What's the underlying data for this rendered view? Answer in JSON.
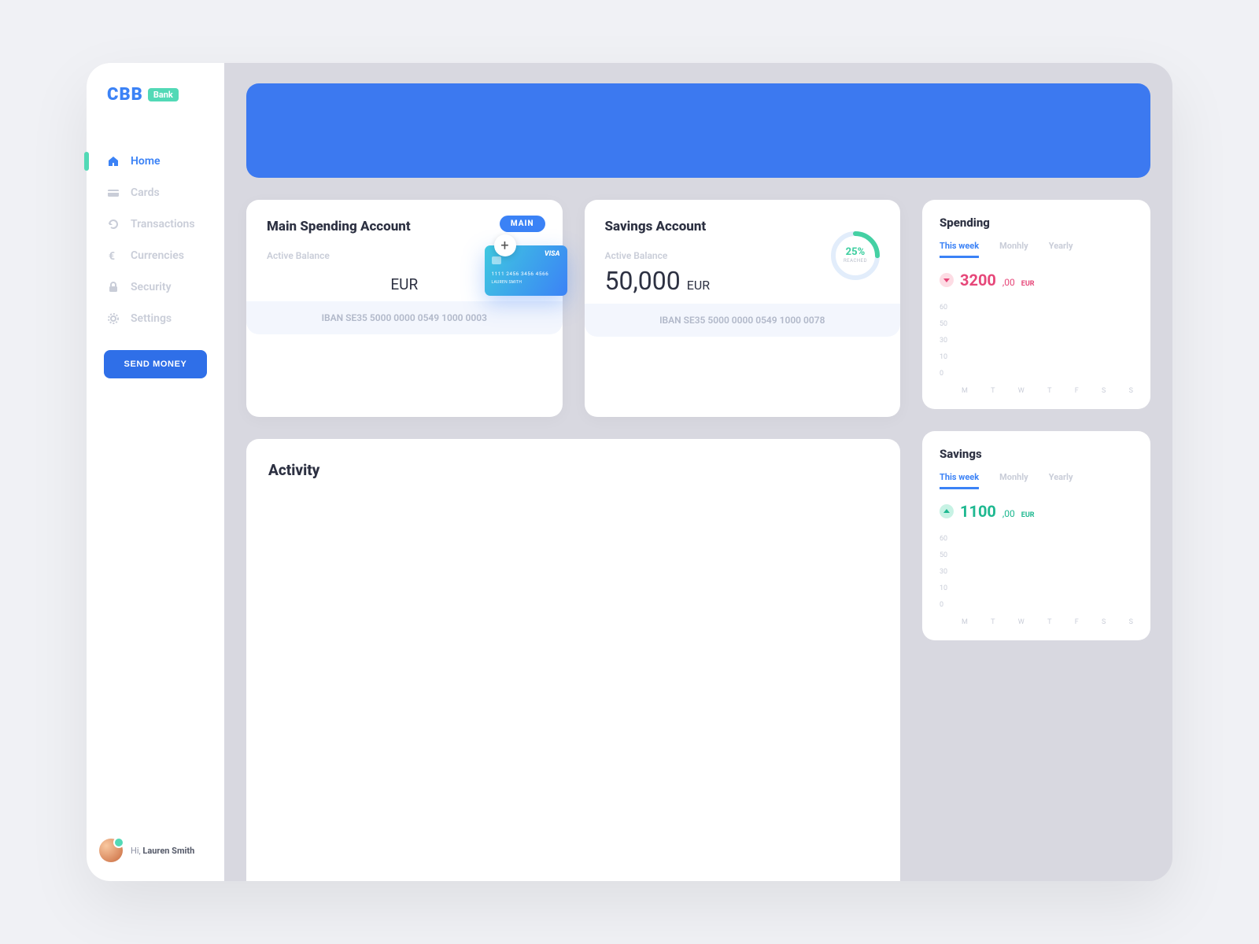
{
  "brand": {
    "main": "CBB",
    "badge": "Bank"
  },
  "sidebar": {
    "items": [
      {
        "label": "Home",
        "icon": "home"
      },
      {
        "label": "Cards",
        "icon": "card"
      },
      {
        "label": "Transactions",
        "icon": "refresh"
      },
      {
        "label": "Currencies",
        "icon": "euro"
      },
      {
        "label": "Security",
        "icon": "lock"
      },
      {
        "label": "Settings",
        "icon": "gear"
      }
    ],
    "cta": "SEND MONEY"
  },
  "user": {
    "greeting": "Hi,",
    "name": "Lauren Smith"
  },
  "accounts": {
    "main": {
      "title": "Main Spending Account",
      "pill": "MAIN",
      "balance_label": "Active Balance",
      "currency": "EUR",
      "iban": "IBAN SE35 5000 0000 0549 1000 0003",
      "card_number": "1111 2456 3456 4566",
      "card_name": "LAUREN SMITH",
      "card_brand": "VISA"
    },
    "savings": {
      "title": "Savings Account",
      "balance_label": "Active Balance",
      "amount": "50,000",
      "currency": "EUR",
      "iban": "IBAN SE35 5000 0000 0549 1000 0078",
      "goal_pct": "25%",
      "goal_label": "REACHED"
    }
  },
  "activity": {
    "title": "Activity"
  },
  "spending": {
    "title": "Spending",
    "tabs": [
      "This week",
      "Monhly",
      "Yearly"
    ],
    "amount": "3200",
    "cents": ",00",
    "currency": "EUR"
  },
  "savings_widget": {
    "title": "Savings",
    "tabs": [
      "This week",
      "Monhly",
      "Yearly"
    ],
    "amount": "1100",
    "cents": ",00",
    "currency": "EUR"
  },
  "chart_data": {
    "y_ticks": [
      "60",
      "50",
      "30",
      "10",
      "0"
    ],
    "x_ticks": [
      "M",
      "T",
      "W",
      "T",
      "F",
      "S",
      "S"
    ]
  }
}
